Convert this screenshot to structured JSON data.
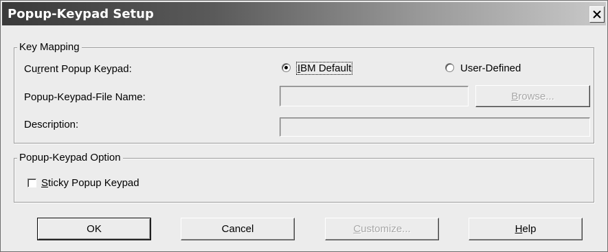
{
  "window": {
    "title": "Popup-Keypad Setup"
  },
  "key_mapping": {
    "legend": "Key Mapping",
    "current_label_pre": "Cu",
    "current_label_mn": "r",
    "current_label_post": "rent Popup Keypad:",
    "radio_ibm_mn": "I",
    "radio_ibm_rest": "BM Default",
    "radio_ibm_selected": true,
    "radio_user_label": "User-Defined",
    "file_label": "Popup-Keypad-File Name:",
    "file_value": "",
    "browse_mn": "B",
    "browse_rest": "rowse...",
    "description_label": "Description:",
    "description_value": ""
  },
  "option": {
    "legend": "Popup-Keypad Option",
    "sticky_mn": "S",
    "sticky_rest": "ticky Popup Keypad",
    "sticky_checked": false
  },
  "buttons": {
    "ok": "OK",
    "cancel": "Cancel",
    "customize_mn": "C",
    "customize_rest": "ustomize...",
    "help_mn": "H",
    "help_rest": "elp"
  }
}
